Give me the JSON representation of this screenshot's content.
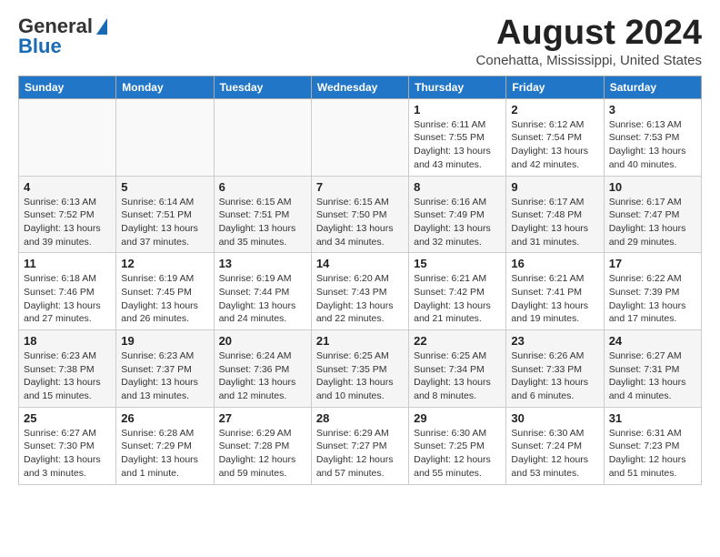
{
  "logo": {
    "general": "General",
    "blue": "Blue"
  },
  "title": "August 2024",
  "location": "Conehatta, Mississippi, United States",
  "days_of_week": [
    "Sunday",
    "Monday",
    "Tuesday",
    "Wednesday",
    "Thursday",
    "Friday",
    "Saturday"
  ],
  "weeks": [
    [
      {
        "day": "",
        "info": ""
      },
      {
        "day": "",
        "info": ""
      },
      {
        "day": "",
        "info": ""
      },
      {
        "day": "",
        "info": ""
      },
      {
        "day": "1",
        "info": "Sunrise: 6:11 AM\nSunset: 7:55 PM\nDaylight: 13 hours\nand 43 minutes."
      },
      {
        "day": "2",
        "info": "Sunrise: 6:12 AM\nSunset: 7:54 PM\nDaylight: 13 hours\nand 42 minutes."
      },
      {
        "day": "3",
        "info": "Sunrise: 6:13 AM\nSunset: 7:53 PM\nDaylight: 13 hours\nand 40 minutes."
      }
    ],
    [
      {
        "day": "4",
        "info": "Sunrise: 6:13 AM\nSunset: 7:52 PM\nDaylight: 13 hours\nand 39 minutes."
      },
      {
        "day": "5",
        "info": "Sunrise: 6:14 AM\nSunset: 7:51 PM\nDaylight: 13 hours\nand 37 minutes."
      },
      {
        "day": "6",
        "info": "Sunrise: 6:15 AM\nSunset: 7:51 PM\nDaylight: 13 hours\nand 35 minutes."
      },
      {
        "day": "7",
        "info": "Sunrise: 6:15 AM\nSunset: 7:50 PM\nDaylight: 13 hours\nand 34 minutes."
      },
      {
        "day": "8",
        "info": "Sunrise: 6:16 AM\nSunset: 7:49 PM\nDaylight: 13 hours\nand 32 minutes."
      },
      {
        "day": "9",
        "info": "Sunrise: 6:17 AM\nSunset: 7:48 PM\nDaylight: 13 hours\nand 31 minutes."
      },
      {
        "day": "10",
        "info": "Sunrise: 6:17 AM\nSunset: 7:47 PM\nDaylight: 13 hours\nand 29 minutes."
      }
    ],
    [
      {
        "day": "11",
        "info": "Sunrise: 6:18 AM\nSunset: 7:46 PM\nDaylight: 13 hours\nand 27 minutes."
      },
      {
        "day": "12",
        "info": "Sunrise: 6:19 AM\nSunset: 7:45 PM\nDaylight: 13 hours\nand 26 minutes."
      },
      {
        "day": "13",
        "info": "Sunrise: 6:19 AM\nSunset: 7:44 PM\nDaylight: 13 hours\nand 24 minutes."
      },
      {
        "day": "14",
        "info": "Sunrise: 6:20 AM\nSunset: 7:43 PM\nDaylight: 13 hours\nand 22 minutes."
      },
      {
        "day": "15",
        "info": "Sunrise: 6:21 AM\nSunset: 7:42 PM\nDaylight: 13 hours\nand 21 minutes."
      },
      {
        "day": "16",
        "info": "Sunrise: 6:21 AM\nSunset: 7:41 PM\nDaylight: 13 hours\nand 19 minutes."
      },
      {
        "day": "17",
        "info": "Sunrise: 6:22 AM\nSunset: 7:39 PM\nDaylight: 13 hours\nand 17 minutes."
      }
    ],
    [
      {
        "day": "18",
        "info": "Sunrise: 6:23 AM\nSunset: 7:38 PM\nDaylight: 13 hours\nand 15 minutes."
      },
      {
        "day": "19",
        "info": "Sunrise: 6:23 AM\nSunset: 7:37 PM\nDaylight: 13 hours\nand 13 minutes."
      },
      {
        "day": "20",
        "info": "Sunrise: 6:24 AM\nSunset: 7:36 PM\nDaylight: 13 hours\nand 12 minutes."
      },
      {
        "day": "21",
        "info": "Sunrise: 6:25 AM\nSunset: 7:35 PM\nDaylight: 13 hours\nand 10 minutes."
      },
      {
        "day": "22",
        "info": "Sunrise: 6:25 AM\nSunset: 7:34 PM\nDaylight: 13 hours\nand 8 minutes."
      },
      {
        "day": "23",
        "info": "Sunrise: 6:26 AM\nSunset: 7:33 PM\nDaylight: 13 hours\nand 6 minutes."
      },
      {
        "day": "24",
        "info": "Sunrise: 6:27 AM\nSunset: 7:31 PM\nDaylight: 13 hours\nand 4 minutes."
      }
    ],
    [
      {
        "day": "25",
        "info": "Sunrise: 6:27 AM\nSunset: 7:30 PM\nDaylight: 13 hours\nand 3 minutes."
      },
      {
        "day": "26",
        "info": "Sunrise: 6:28 AM\nSunset: 7:29 PM\nDaylight: 13 hours\nand 1 minute."
      },
      {
        "day": "27",
        "info": "Sunrise: 6:29 AM\nSunset: 7:28 PM\nDaylight: 12 hours\nand 59 minutes."
      },
      {
        "day": "28",
        "info": "Sunrise: 6:29 AM\nSunset: 7:27 PM\nDaylight: 12 hours\nand 57 minutes."
      },
      {
        "day": "29",
        "info": "Sunrise: 6:30 AM\nSunset: 7:25 PM\nDaylight: 12 hours\nand 55 minutes."
      },
      {
        "day": "30",
        "info": "Sunrise: 6:30 AM\nSunset: 7:24 PM\nDaylight: 12 hours\nand 53 minutes."
      },
      {
        "day": "31",
        "info": "Sunrise: 6:31 AM\nSunset: 7:23 PM\nDaylight: 12 hours\nand 51 minutes."
      }
    ]
  ]
}
